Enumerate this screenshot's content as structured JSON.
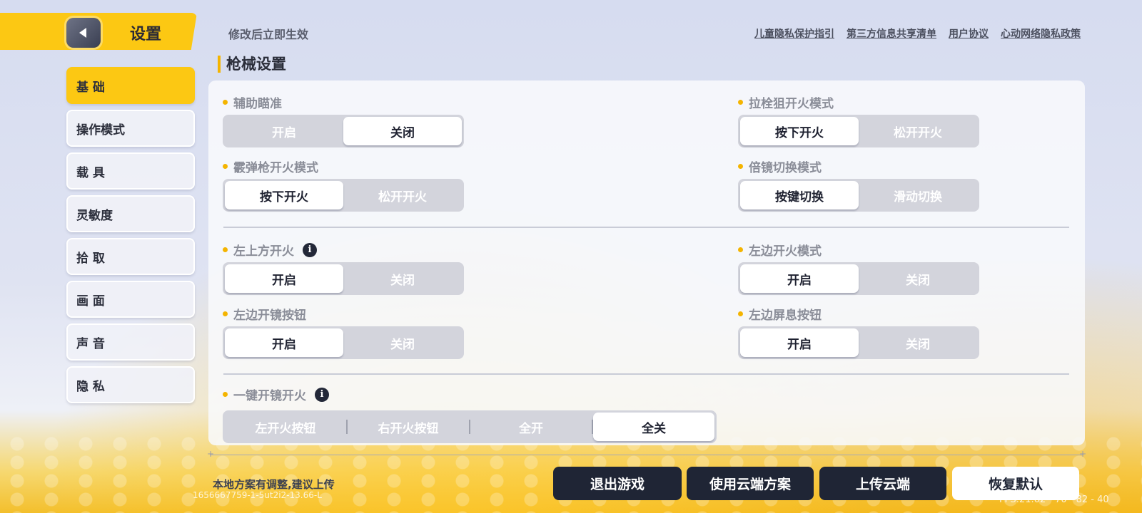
{
  "header": {
    "title": "设置",
    "notice": "修改后立即生效",
    "links": [
      "儿童隐私保护指引",
      "第三方信息共享清单",
      "用户协议",
      "心动网络隐私政策"
    ]
  },
  "sidebar": {
    "items": [
      {
        "label": "基 础",
        "active": true
      },
      {
        "label": "操作模式",
        "active": false
      },
      {
        "label": "载 具",
        "active": false
      },
      {
        "label": "灵敏度",
        "active": false
      },
      {
        "label": "拾 取",
        "active": false
      },
      {
        "label": "画 面",
        "active": false
      },
      {
        "label": "声 音",
        "active": false
      },
      {
        "label": "隐 私",
        "active": false
      }
    ]
  },
  "section": {
    "title": "枪械设置"
  },
  "settings": {
    "aim_assist": {
      "label": "辅助瞄准",
      "options": [
        "开启",
        "关闭"
      ],
      "selected": "关闭"
    },
    "bolt_sniper": {
      "label": "拉栓狙开火模式",
      "options": [
        "按下开火",
        "松开开火"
      ],
      "selected": "按下开火"
    },
    "shotgun": {
      "label": "霰弹枪开火模式",
      "options": [
        "按下开火",
        "松开开火"
      ],
      "selected": "按下开火"
    },
    "scope_switch": {
      "label": "倍镜切换模式",
      "options": [
        "按键切换",
        "滑动切换"
      ],
      "selected": "按键切换"
    },
    "top_left_fire": {
      "label": "左上方开火",
      "options": [
        "开启",
        "关闭"
      ],
      "selected": "开启"
    },
    "left_fire_mode": {
      "label": "左边开火模式",
      "options": [
        "开启",
        "关闭"
      ],
      "selected": "开启"
    },
    "left_scope_btn": {
      "label": "左边开镜按钮",
      "options": [
        "开启",
        "关闭"
      ],
      "selected": "开启"
    },
    "left_hold_breath": {
      "label": "左边屏息按钮",
      "options": [
        "开启",
        "关闭"
      ],
      "selected": "开启"
    },
    "one_key_scope": {
      "label": "一键开镜开火",
      "options": [
        "左开火按钮",
        "右开火按钮",
        "全开",
        "全关"
      ],
      "selected": "全关"
    }
  },
  "footer": {
    "local_msg": "本地方案有调整,建议上传",
    "build_id": "1656667759-1-5ut2i2-13.66-L",
    "fps": "FPS:21.02 - 70 - 82 - 40",
    "buttons": {
      "exit": "退出游戏",
      "use_cloud": "使用云端方案",
      "upload": "上传云端",
      "restore": "恢复默认"
    }
  },
  "icons": {
    "back": "back-arrow-icon",
    "info": "info-icon"
  },
  "colors": {
    "accent": "#fcc813",
    "dark_button": "#1f2535",
    "selected_option": "#ffffff",
    "segment_bg": "#d3d4dc"
  }
}
